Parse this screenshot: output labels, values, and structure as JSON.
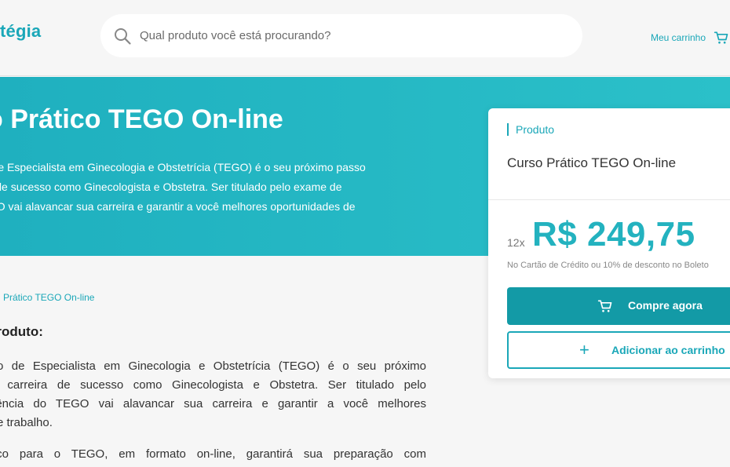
{
  "header": {
    "logo_text": "tégia",
    "search_placeholder": "Qual produto você está procurando?",
    "cart_label": "Meu carrinho"
  },
  "hero": {
    "title": "o Prático TEGO On-line",
    "description_lines": [
      "ulo de Especialista em Ginecologia e Obstetrícia (TEGO) é o seu próximo passo",
      "eira de sucesso como Ginecologista e Obstetra. Ser titulado pelo exame de",
      "TEGO vai alavancar sua carreira e garantir a você melhores oportunidades de"
    ]
  },
  "breadcrumb": {
    "current": "Prático TEGO On-line"
  },
  "about": {
    "heading": "produto:",
    "paragraph1_lines": [
      "ítulo de Especialista em Ginecologia e Obstetrícia (TEGO) é o seu próximo",
      "ma carreira de sucesso como Ginecologista e Obstetra. Ser titulado pelo",
      "ficiência do TEGO vai alavancar sua carreira e garantir a você melhores",
      "s de trabalho."
    ],
    "paragraph2": "prático para o TEGO, em formato on-line, garantirá sua preparação com"
  },
  "product_card": {
    "tag": "Produto",
    "name": "Curso Prático TEGO On-line",
    "installments": "12x",
    "price": "R$ 249,75",
    "payment_note": "No Cartão de Crédito ou 10% de desconto no Boleto",
    "buy_label": "Compre agora",
    "add_label": "Adicionar ao carrinho",
    "accent_color": "#1aa7b8",
    "buy_button_color": "#139aa6"
  }
}
